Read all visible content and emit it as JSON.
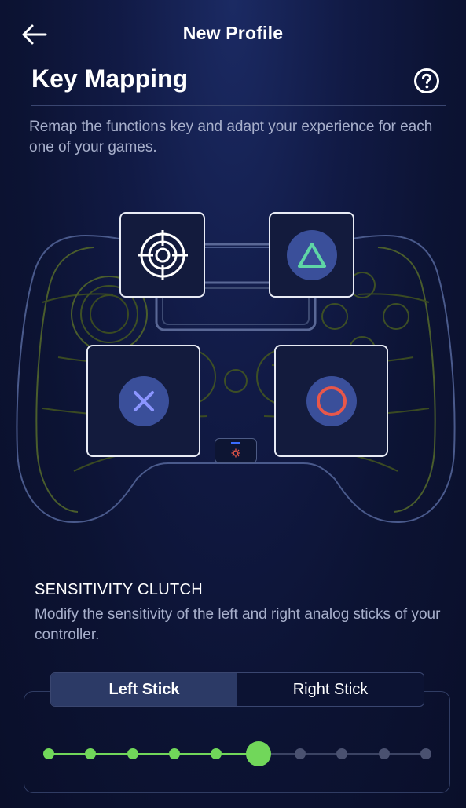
{
  "header": {
    "title": "New Profile"
  },
  "page": {
    "title": "Key Mapping",
    "subtitle": "Remap the functions key and adapt your experience for each one of your games."
  },
  "sensitivity": {
    "title": "SENSITIVITY CLUTCH",
    "description": "Modify the sensitivity of the left and right analog sticks of your controller.",
    "tabs": [
      {
        "label": "Left Stick",
        "active": true
      },
      {
        "label": "Right Stick",
        "active": false
      }
    ],
    "slider": {
      "steps": 10,
      "current_step": 6
    }
  },
  "colors": {
    "accent": "#71d75a",
    "cross": "#8b95ff",
    "circle": "#e8574a",
    "triangle": "#5fd6a6",
    "button_fill": "#3a4f9a"
  },
  "icons": {
    "back": "arrow-left-icon",
    "help": "question-circle-icon",
    "crosshair": "crosshair-icon",
    "triangle": "triangle-icon",
    "cross": "cross-icon",
    "circle": "circle-icon",
    "gear": "gear-icon"
  }
}
